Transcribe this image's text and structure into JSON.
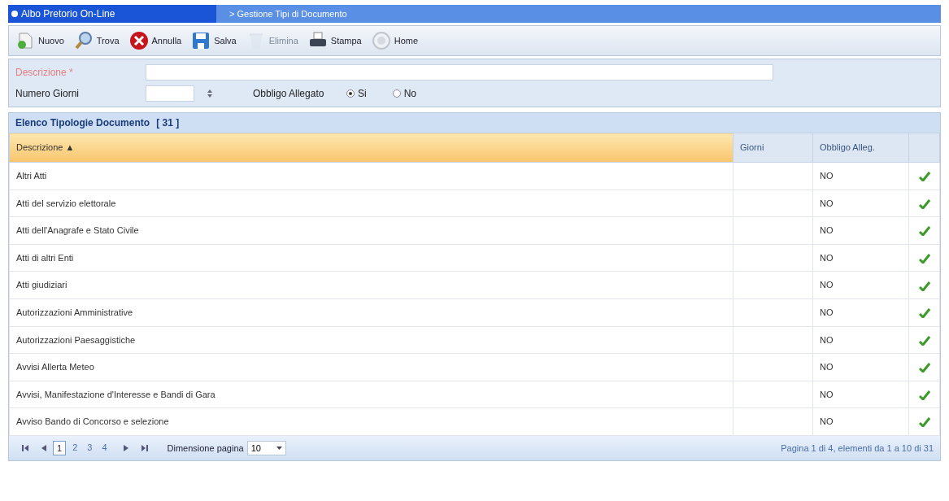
{
  "header": {
    "title": "Albo Pretorio On-Line",
    "breadcrumb": "> Gestione Tipi di Documento"
  },
  "toolbar": [
    {
      "label": "Nuovo",
      "kind": "new",
      "disabled": false
    },
    {
      "label": "Trova",
      "kind": "find",
      "disabled": false
    },
    {
      "label": "Annulla",
      "kind": "cancel",
      "disabled": false
    },
    {
      "label": "Salva",
      "kind": "save",
      "disabled": false
    },
    {
      "label": "Elimina",
      "kind": "delete",
      "disabled": true
    },
    {
      "label": "Stampa",
      "kind": "print",
      "disabled": false
    },
    {
      "label": "Home",
      "kind": "home",
      "disabled": false
    }
  ],
  "form": {
    "descrizione_label": "Descrizione *",
    "giorni_label": "Numero Giorni",
    "allegato_label": "Obbligo Allegato",
    "options": [
      {
        "label": "Si",
        "selected": true
      },
      {
        "label": "No",
        "selected": false
      }
    ]
  },
  "grid": {
    "title": "Elenco Tipologie Documento",
    "count": "[ 31 ]",
    "columns": [
      "Descrizione ▲",
      "Giorni",
      "Obbligo Alleg."
    ],
    "rows": [
      [
        "Altri Atti",
        "NO"
      ],
      [
        "Atti del servizio elettorale",
        "NO"
      ],
      [
        "Atti dell'Anagrafe e Stato Civile",
        "NO"
      ],
      [
        "Atti di altri Enti",
        "NO"
      ],
      [
        "Atti giudiziari",
        "NO"
      ],
      [
        "Autorizzazioni Amministrative",
        "NO"
      ],
      [
        "Autorizzazioni Paesaggistiche",
        "NO"
      ],
      [
        "Avvisi Allerta Meteo",
        "NO"
      ],
      [
        "Avvisi, Manifestazione d'Interesse e Bandi di Gara",
        "NO"
      ],
      [
        "Avviso Bando di Concorso e selezione",
        "NO"
      ]
    ]
  },
  "pager": {
    "pages": [
      {
        "label": "1",
        "selected": true
      },
      {
        "label": "2",
        "selected": false
      },
      {
        "label": "3",
        "selected": false
      },
      {
        "label": "4",
        "selected": false
      }
    ],
    "size_label": "Dimensione pagina",
    "size": "10",
    "summary": "Pagina 1 di 4, elementi da 1 a 10 di 31"
  }
}
